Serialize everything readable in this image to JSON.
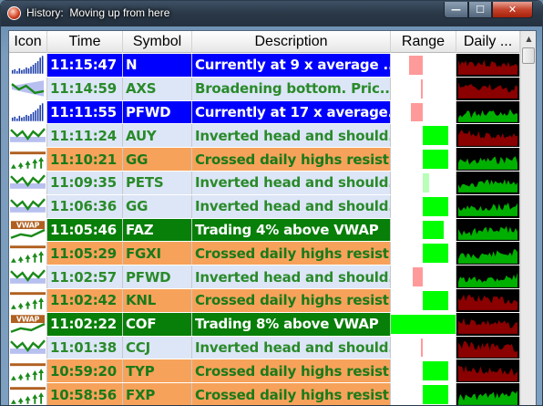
{
  "window": {
    "title": "History:  Moving up from here",
    "buttons": {
      "minimize": "—",
      "maximize": "☐",
      "close": "✕"
    }
  },
  "columns": [
    "Icon",
    "Time",
    "Symbol",
    "Description",
    "Range",
    "Daily ..."
  ],
  "colors": {
    "blue_bg": "#0000ff",
    "blue_fg": "#ffffff",
    "light_bg": "#dce6f7",
    "light_fg": "#2a8a2a",
    "orange_bg": "#f7a25a",
    "orange_fg": "#1a7a1a",
    "green_bg": "#087f08",
    "green_fg": "#ffffff",
    "range_pink": "#ff9a9a",
    "range_green": "#00ff00",
    "range_light_green": "#b8ffb8",
    "daily_red": "#8b0000",
    "daily_green": "#00b000"
  },
  "rows": [
    {
      "icon": "volume-spike-icon",
      "time": "11:15:47",
      "symbol": "N",
      "description": "Currently at 9 x average ...",
      "style": "blue",
      "range": {
        "color": "pink",
        "from": 0.28,
        "to": 0.48
      },
      "daily": "red"
    },
    {
      "icon": "broadening-bottom-icon",
      "time": "11:14:59",
      "symbol": "AXS",
      "description": "Broadening bottom.  Pric...",
      "style": "light",
      "range": {
        "color": "pink",
        "from": 0.46,
        "to": 0.48
      },
      "daily": "red"
    },
    {
      "icon": "volume-spike-icon",
      "time": "11:11:55",
      "symbol": "PFWD",
      "description": "Currently at 17 x average...",
      "style": "blue",
      "range": {
        "color": "pink",
        "from": 0.3,
        "to": 0.48
      },
      "daily": "green"
    },
    {
      "icon": "inverted-head-shoulders-icon",
      "time": "11:11:24",
      "symbol": "AUY",
      "description": "Inverted head and should...",
      "style": "light",
      "range": {
        "color": "green",
        "from": 0.48,
        "to": 0.88
      },
      "daily": "red"
    },
    {
      "icon": "crossed-highs-icon",
      "time": "11:10:21",
      "symbol": "GG",
      "description": "Crossed daily highs resist...",
      "style": "orange",
      "range": {
        "color": "green",
        "from": 0.48,
        "to": 0.88
      },
      "daily": "green"
    },
    {
      "icon": "inverted-head-shoulders-icon",
      "time": "11:09:35",
      "symbol": "PETS",
      "description": "Inverted head and should...",
      "style": "light",
      "range": {
        "color": "lightgreen",
        "from": 0.48,
        "to": 0.58
      },
      "daily": "green"
    },
    {
      "icon": "inverted-head-shoulders-icon",
      "time": "11:06:36",
      "symbol": "GG",
      "description": "Inverted head and should...",
      "style": "light",
      "range": {
        "color": "green",
        "from": 0.48,
        "to": 0.88
      },
      "daily": "green"
    },
    {
      "icon": "vwap-icon",
      "time": "11:05:46",
      "symbol": "FAZ",
      "description": "Trading 4% above VWAP",
      "style": "green",
      "range": {
        "color": "green",
        "from": 0.48,
        "to": 0.8
      },
      "daily": "green"
    },
    {
      "icon": "crossed-highs-icon",
      "time": "11:05:29",
      "symbol": "FGXI",
      "description": "Crossed daily highs resist...",
      "style": "orange",
      "range": {
        "color": "green",
        "from": 0.48,
        "to": 0.88
      },
      "daily": "green"
    },
    {
      "icon": "inverted-head-shoulders-icon",
      "time": "11:02:57",
      "symbol": "PFWD",
      "description": "Inverted head and should...",
      "style": "light",
      "range": {
        "color": "pink",
        "from": 0.34,
        "to": 0.48
      },
      "daily": "green"
    },
    {
      "icon": "crossed-highs-icon",
      "time": "11:02:42",
      "symbol": "KNL",
      "description": "Crossed daily highs resist...",
      "style": "orange",
      "range": {
        "color": "green",
        "from": 0.48,
        "to": 0.88
      },
      "daily": "red"
    },
    {
      "icon": "vwap-icon",
      "time": "11:02:22",
      "symbol": "COF",
      "description": "Trading 8% above VWAP",
      "style": "green",
      "range": {
        "color": "green",
        "from": 0.0,
        "to": 0.98
      },
      "daily": "red"
    },
    {
      "icon": "inverted-head-shoulders-icon",
      "time": "11:01:38",
      "symbol": "CCJ",
      "description": "Inverted head and should...",
      "style": "light",
      "range": {
        "color": "pink",
        "from": 0.46,
        "to": 0.48
      },
      "daily": "red"
    },
    {
      "icon": "crossed-highs-icon",
      "time": "10:59:20",
      "symbol": "TYP",
      "description": "Crossed daily highs resist...",
      "style": "orange",
      "range": {
        "color": "green",
        "from": 0.48,
        "to": 0.88
      },
      "daily": "red"
    },
    {
      "icon": "crossed-highs-icon",
      "time": "10:58:56",
      "symbol": "FXP",
      "description": "Crossed daily highs resist...",
      "style": "orange",
      "range": {
        "color": "green",
        "from": 0.48,
        "to": 0.88
      },
      "daily": "green"
    }
  ]
}
